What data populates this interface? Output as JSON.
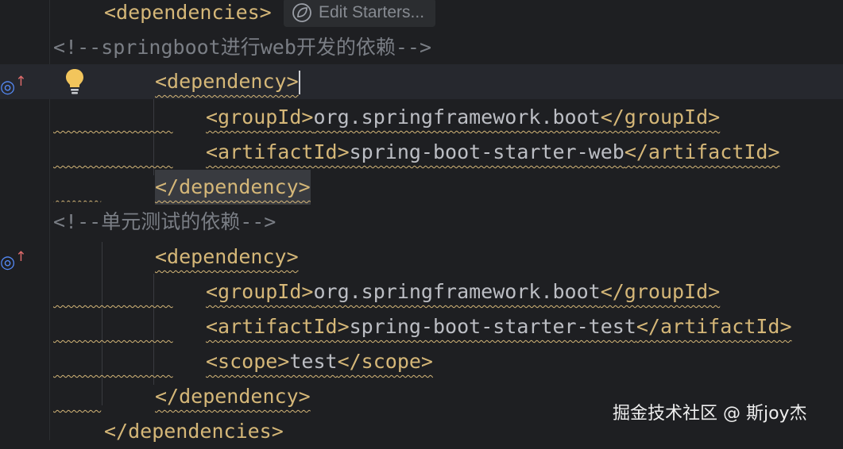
{
  "editor": {
    "inlay_hint": {
      "label": "Edit Starters...",
      "icon": "spring-leaf-icon"
    },
    "lines": {
      "l0": {
        "text": "<dependencies>"
      },
      "l1": {
        "text": "<!--springboot进行web开发的依赖-->"
      },
      "l2": {
        "text": "<dependency>"
      },
      "l3": {
        "open": "<groupId>",
        "value": "org.springframework.boot",
        "close": "</groupId>"
      },
      "l4": {
        "open": "<artifactId>",
        "value": "spring-boot-starter-web",
        "close": "</artifactId>"
      },
      "l5": {
        "text": "</dependency>"
      },
      "l6": {
        "text": "<!--单元测试的依赖-->"
      },
      "l7": {
        "text": "<dependency>"
      },
      "l8": {
        "open": "<groupId>",
        "value": "org.springframework.boot",
        "close": "</groupId>"
      },
      "l9": {
        "open": "<artifactId>",
        "value": "spring-boot-starter-test",
        "close": "</artifactId>"
      },
      "l10": {
        "open": "<scope>",
        "value": "test",
        "close": "</scope>"
      },
      "l11": {
        "text": "</dependency>"
      },
      "l12": {
        "text": "</dependencies>"
      }
    },
    "gutter": {
      "marker_icon": "target-up-arrow-icon",
      "intention_icon": "lightbulb-icon"
    }
  },
  "watermark": "掘金技术社区 @ 斯joy杰",
  "colors": {
    "background": "#1e1f22",
    "tag": "#d5b778",
    "text": "#bcbec4",
    "comment": "#7a7e85",
    "warning_underline": "#d5b778",
    "marker_blue": "#548af7",
    "marker_red": "#e06c6c",
    "bulb": "#f2c55c"
  }
}
